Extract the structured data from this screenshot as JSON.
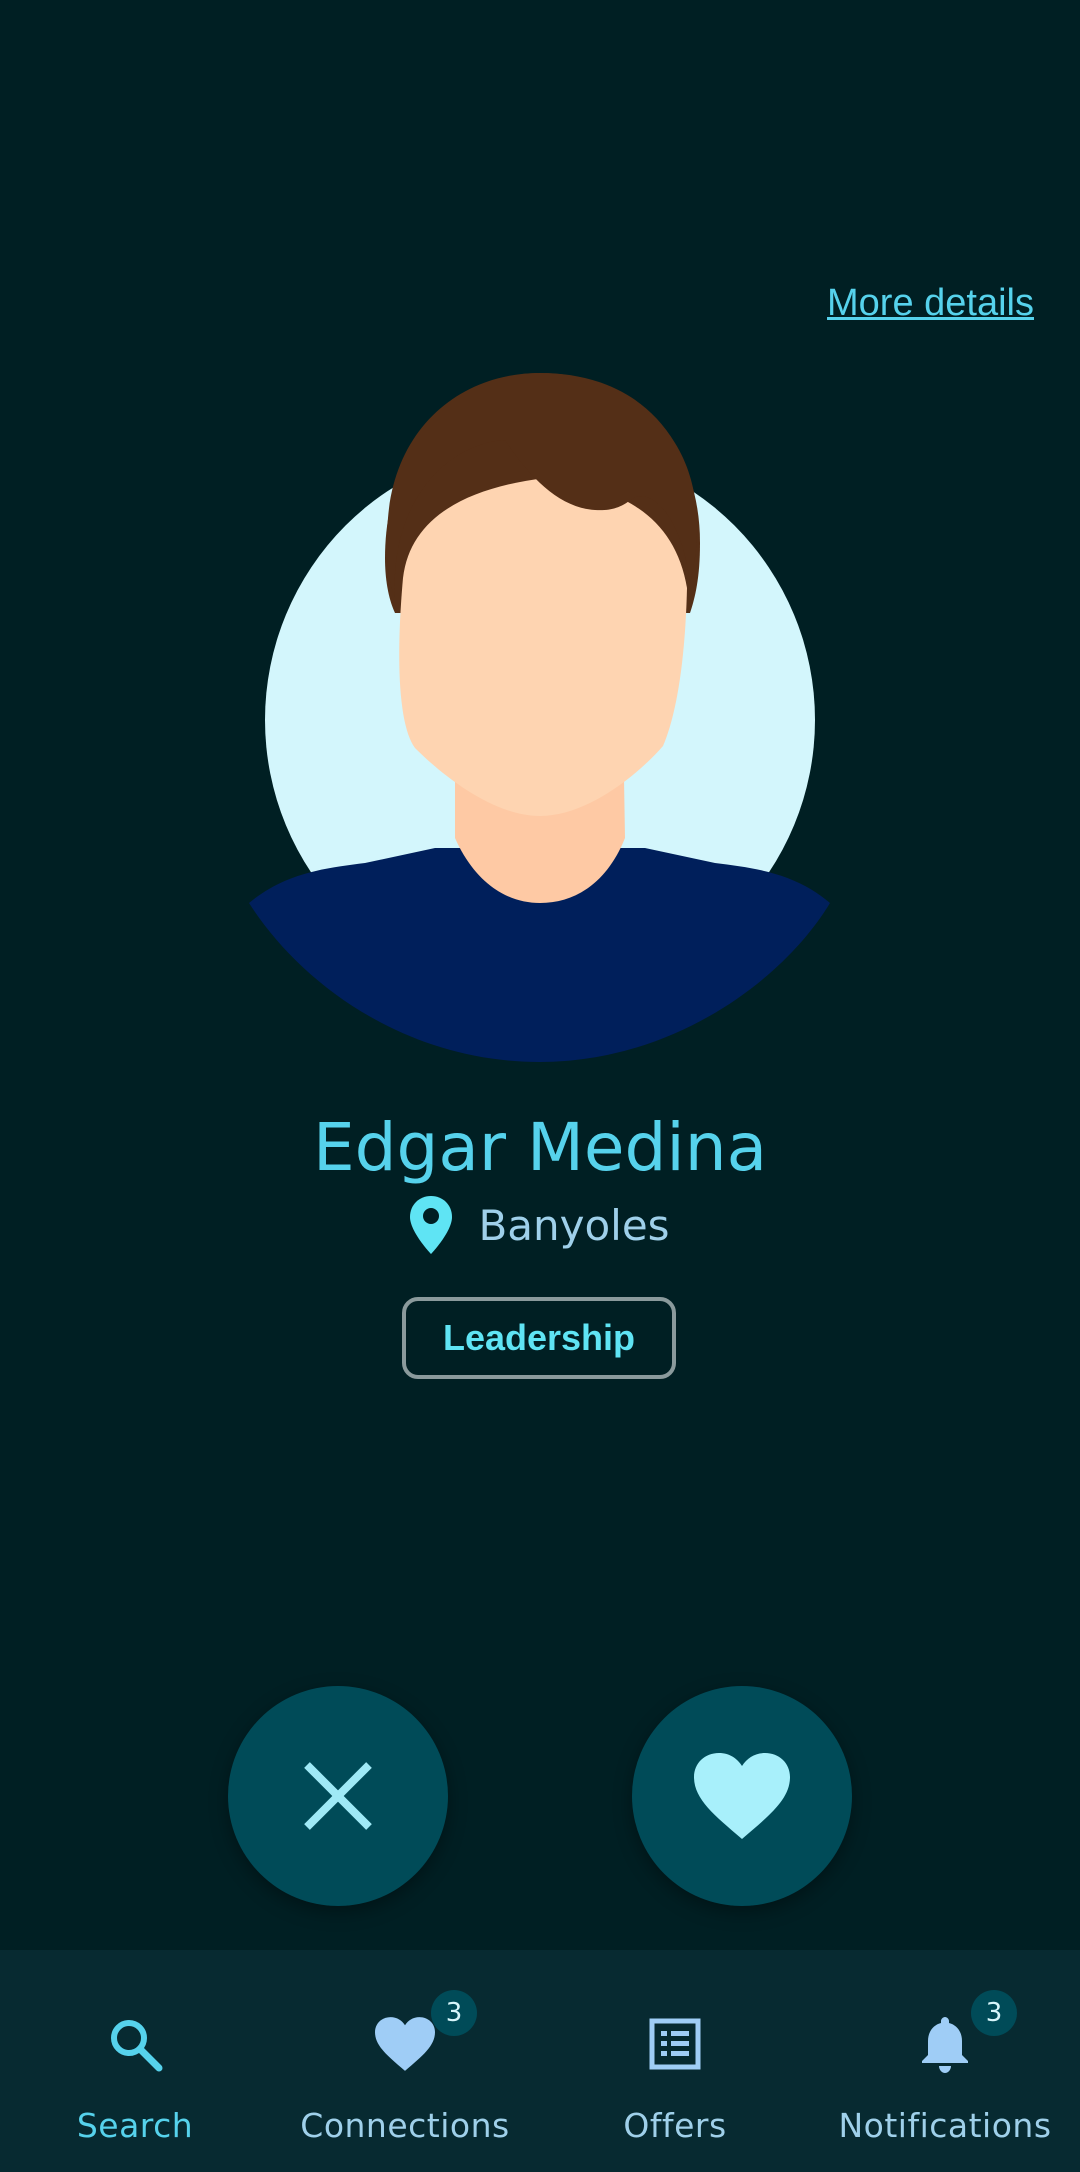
{
  "header": {
    "more_details_label": "More details"
  },
  "profile": {
    "name": "Edgar Medina",
    "location": "Banyoles",
    "skill_chip": "Leadership"
  },
  "actions": {
    "dislike_icon": "close-icon",
    "like_icon": "heart-icon"
  },
  "bottom_nav": {
    "items": [
      {
        "label": "Search",
        "icon": "search-icon",
        "active": true
      },
      {
        "label": "Connections",
        "icon": "heart-icon",
        "badge": "3"
      },
      {
        "label": "Offers",
        "icon": "list-icon"
      },
      {
        "label": "Notifications",
        "icon": "bell-icon",
        "badge": "3"
      }
    ]
  },
  "colors": {
    "background": "#001f23",
    "accent": "#56d2ec",
    "fab": "#004b58",
    "nav_bg": "#072a31"
  }
}
